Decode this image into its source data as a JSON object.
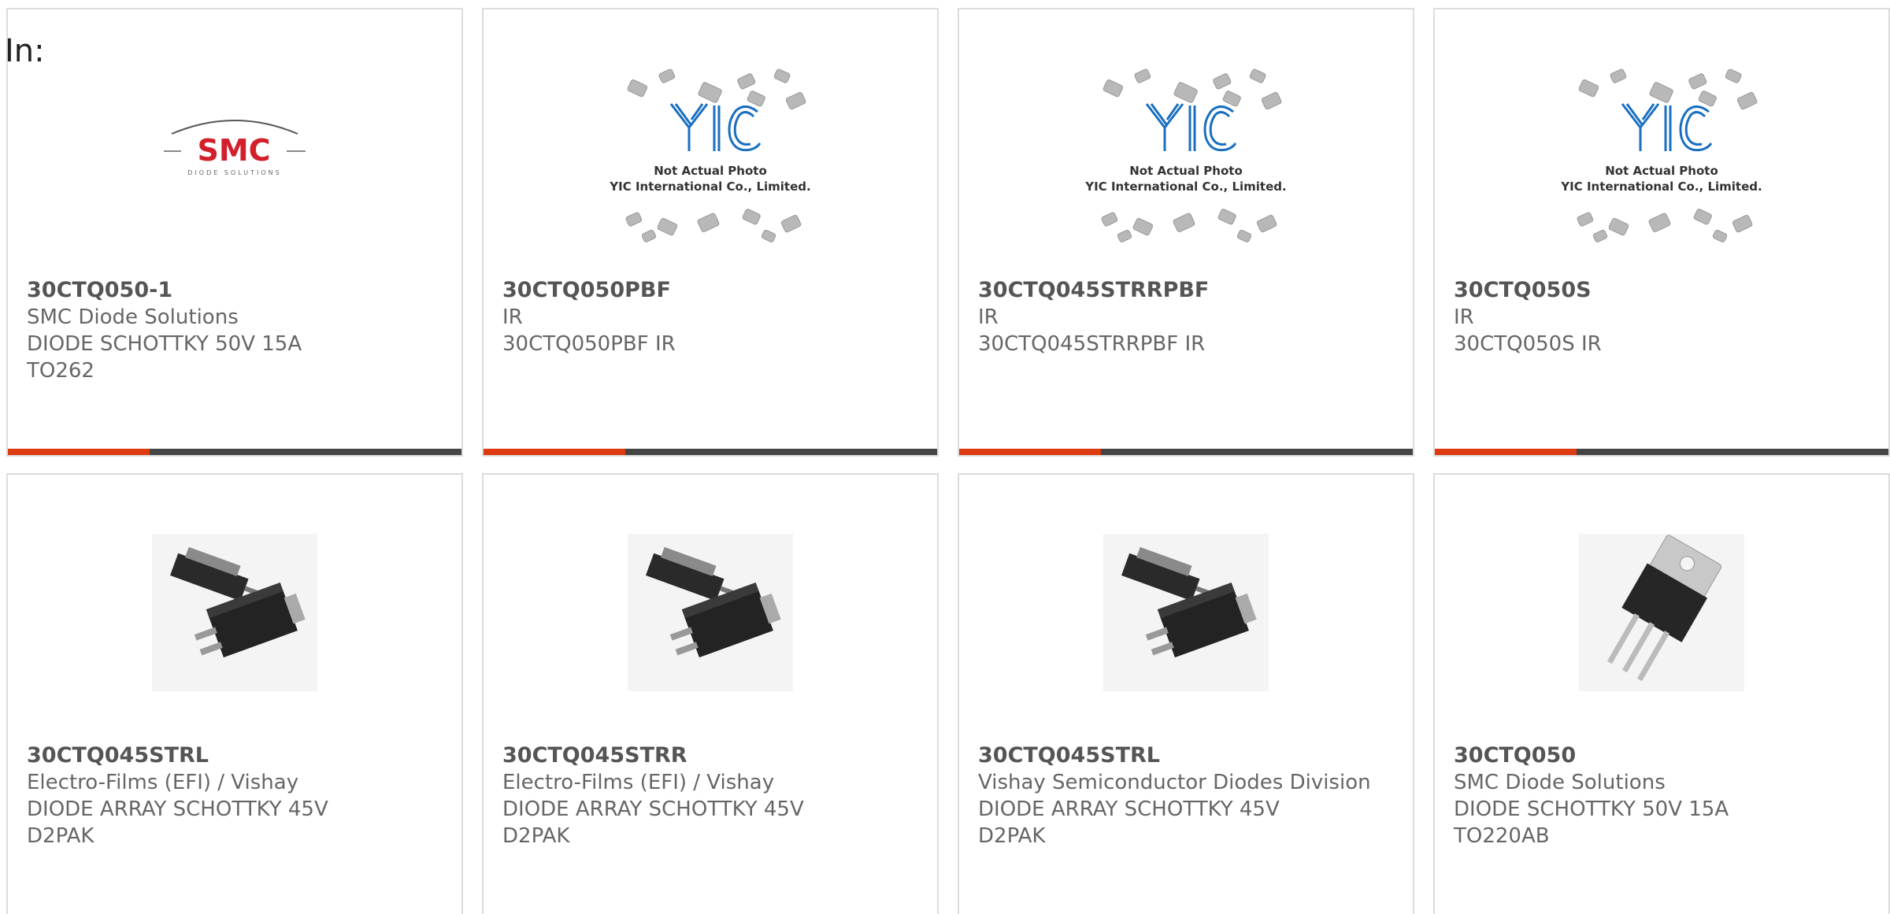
{
  "header": {
    "in_label": "In:"
  },
  "cards": [
    {
      "part_number": "30CTQ050-1",
      "manufacturer": "SMC Diode Solutions",
      "description": "DIODE SCHOTTKY 50V 15A",
      "package": "TO262",
      "image": "smc-logo",
      "logo_text": "SMC",
      "logo_sub": "DIODE SOLUTIONS"
    },
    {
      "part_number": "30CTQ050PBF",
      "manufacturer": "IR",
      "description": "30CTQ050PBF IR",
      "package": "",
      "image": "yic-placeholder",
      "ph_line1": "Not Actual Photo",
      "ph_line2": "YIC International Co., Limited."
    },
    {
      "part_number": "30CTQ045STRRPBF",
      "manufacturer": "IR",
      "description": "30CTQ045STRRPBF IR",
      "package": "",
      "image": "yic-placeholder",
      "ph_line1": "Not Actual Photo",
      "ph_line2": "YIC International Co., Limited."
    },
    {
      "part_number": "30CTQ050S",
      "manufacturer": "IR",
      "description": "30CTQ050S IR",
      "package": "",
      "image": "yic-placeholder",
      "ph_line1": "Not Actual Photo",
      "ph_line2": "YIC International Co., Limited."
    },
    {
      "part_number": "30CTQ045STRL",
      "manufacturer": "Electro-Films (EFI) / Vishay",
      "description": "DIODE ARRAY SCHOTTKY 45V",
      "package": "D2PAK",
      "image": "d2pak-photo"
    },
    {
      "part_number": "30CTQ045STRR",
      "manufacturer": "Electro-Films (EFI) / Vishay",
      "description": "DIODE ARRAY SCHOTTKY 45V",
      "package": "D2PAK",
      "image": "d2pak-photo"
    },
    {
      "part_number": "30CTQ045STRL",
      "manufacturer": "Vishay Semiconductor Diodes Division",
      "description": "DIODE ARRAY SCHOTTKY 45V",
      "package": "D2PAK",
      "image": "d2pak-photo"
    },
    {
      "part_number": "30CTQ050",
      "manufacturer": "SMC Diode Solutions",
      "description": "DIODE SCHOTTKY 50V 15A",
      "package": "TO220AB",
      "image": "to220-photo"
    }
  ],
  "colors": {
    "accent": "#dd3a10",
    "bar_dark": "#444444",
    "card_border": "#dcdcdc",
    "yic_blue": "#1a6fc0",
    "smc_red": "#d31f2b"
  }
}
